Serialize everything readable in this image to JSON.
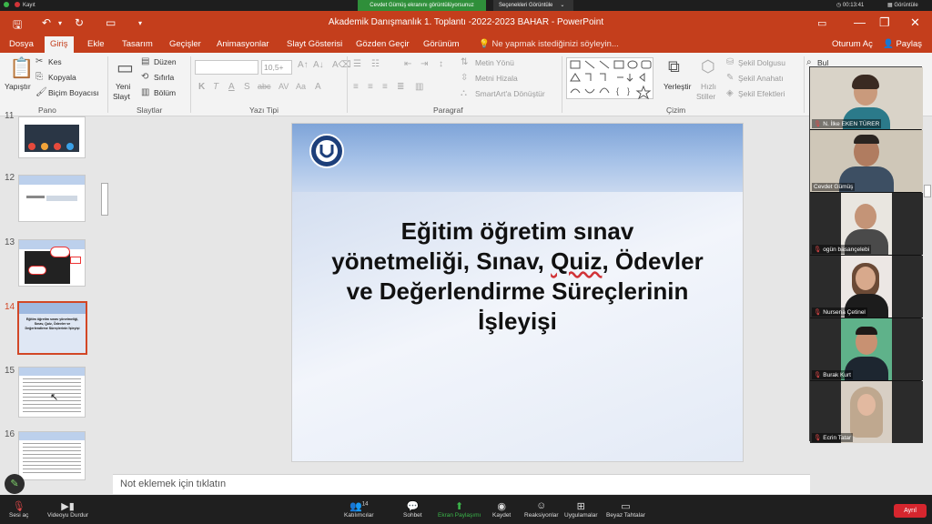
{
  "zoom_top": {
    "recording_label": "Kayıt",
    "share_banner": "Cevdet Gümüş ekranını görüntülüyorsunuz",
    "view_options": "Seçenekleri Görüntüle",
    "timer": "00:13:41",
    "view_button": "Görüntüle"
  },
  "window": {
    "title": "Akademik Danışmanlık 1. Toplantı -2022-2023 BAHAR  -  PowerPoint"
  },
  "tabs": [
    "Dosya",
    "Giriş",
    "Ekle",
    "Tasarım",
    "Geçişler",
    "Animasyonlar",
    "Slayt Gösterisi",
    "Gözden Geçir",
    "Görünüm"
  ],
  "tell_me": "Ne yapmak istediğinizi söyleyin...",
  "signin": "Oturum Aç",
  "share": "Paylaş",
  "ribbon": {
    "paste": "Yapıştır",
    "cut": "Kes",
    "copy": "Kopyala",
    "format_painter": "Biçim Boyacısı",
    "new_slide_1": "Yeni",
    "new_slide_2": "Slayt",
    "layout": "Düzen",
    "reset": "Sıfırla",
    "section": "Bölüm",
    "font_size": "10,5+",
    "text_direction": "Metin Yönü",
    "align_text": "Metni Hizala",
    "smartart": "SmartArt'a Dönüştür",
    "arrange": "Yerleştir",
    "quick_styles_1": "Hızlı",
    "quick_styles_2": "Stiller",
    "shape_fill": "Şekil Dolgusu",
    "shape_outline": "Şekil Anahatı",
    "shape_effects": "Şekil Efektleri",
    "find": "Bul",
    "groups": {
      "clipboard": "Pano",
      "slides": "Slaytlar",
      "font": "Yazı Tipi",
      "paragraph": "Paragraf",
      "drawing": "Çizim"
    }
  },
  "thumbnails": [
    {
      "num": "11"
    },
    {
      "num": "12"
    },
    {
      "num": "13"
    },
    {
      "num": "14",
      "text": "Eğitim öğretim sınav yönetmeliği, Sınav, Quiz, Ödevler ve Değerlendirme Süreçlerinin İşleyişi"
    },
    {
      "num": "15"
    },
    {
      "num": "16"
    }
  ],
  "slide": {
    "title_line1": "Eğitim öğretim sınav",
    "title_line2a": "yönetmeliği, Sınav, ",
    "title_line2b": "Quiz",
    "title_line2c": ", Ödevler",
    "title_line3": "ve Değerlendirme Süreçlerinin",
    "title_line4": "İşleyişi"
  },
  "notes_placeholder": "Not eklemek için tıklatın",
  "participants": [
    {
      "name": "N. İlke EKEN TÜRER",
      "muted": true
    },
    {
      "name": "Cevdet Gümüş",
      "muted": false
    },
    {
      "name": "ogün basançelebi",
      "muted": true
    },
    {
      "name": "Nursena Çetinel",
      "muted": true
    },
    {
      "name": "Burak Kurt",
      "muted": true
    },
    {
      "name": "Ecrin Tatar",
      "muted": true
    }
  ],
  "bottom_bar": {
    "unmute": "Sesi aç",
    "stop_video": "Videoyu Durdur",
    "participants": "Katılımcılar",
    "participants_count": "14",
    "chat": "Sohbet",
    "share_screen": "Ekran Paylaşımı",
    "record": "Kaydet",
    "reactions": "Reaksiyonlar",
    "apps": "Uygulamalar",
    "whiteboards": "Beyaz Tahtalar",
    "leave": "Ayrıl"
  },
  "colors": {
    "ppt_accent": "#c43e1c",
    "selection": "#d24726",
    "zoom_green": "#2f8f3a",
    "leave_red": "#d6262e"
  }
}
